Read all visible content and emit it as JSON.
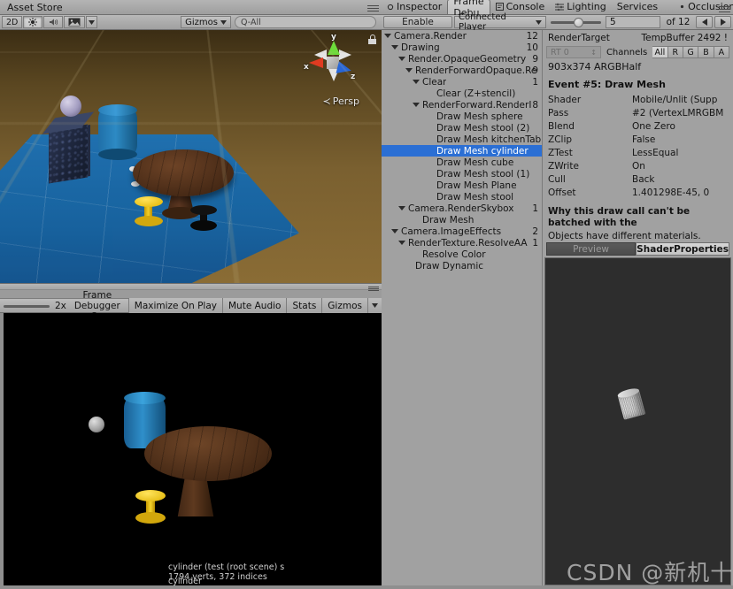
{
  "left_panel": {
    "tab_label": "Asset Store",
    "scene_toolbar": {
      "mode_2d": "2D",
      "lighting_icon": "sun-icon",
      "audio_icon": "speaker-icon",
      "fx_icon": "image-effects-icon",
      "fx_dropdown_icon": "chevron-down-icon",
      "gizmos_label": "Gizmos",
      "gizmos_dropdown_icon": "chevron-down-icon",
      "search_placeholder": "Q-All",
      "search_value": "Q-All",
      "search_icon": "search-icon"
    },
    "scene_view": {
      "axis_gizmo": {
        "x_label": "x",
        "y_label": "y",
        "z_label": "z"
      },
      "projection_label": "Persp",
      "projection_arrow_icon": "chevron-left-icon",
      "lock_icon": "lock-icon",
      "objects": [
        "cube",
        "sphere",
        "cylinder",
        "kitchenTable",
        "stool",
        "stool (1)",
        "stool (2)",
        "Plane"
      ]
    },
    "game_toolbar": {
      "zoom_value": "2x",
      "status": "Frame Debugger On",
      "maximize_on_play": "Maximize On Play",
      "mute_audio": "Mute Audio",
      "stats": "Stats",
      "gizmos": "Gizmos",
      "gizmos_dropdown_icon": "chevron-down-icon"
    }
  },
  "right_panel": {
    "tabs": [
      {
        "label": "Inspector",
        "icon": "inspector-icon",
        "selected": false
      },
      {
        "label": "Frame Debu",
        "icon": "",
        "selected": true
      },
      {
        "label": "Console",
        "icon": "console-icon",
        "selected": false
      },
      {
        "label": "Lighting",
        "icon": "lighting-icon",
        "selected": false
      },
      {
        "label": "Services",
        "icon": "",
        "selected": false
      },
      {
        "label": "Occlusion",
        "icon": "occlusion-icon",
        "selected": false
      }
    ],
    "toolbar": {
      "enable_label": "Enable",
      "target_label": "Connected Player",
      "target_dropdown_icon": "chevron-down-icon",
      "event_index": "5",
      "event_total": "of 12",
      "prev_icon": "arrow-left-icon",
      "next_icon": "arrow-right-icon"
    },
    "tree": [
      {
        "label": "Camera.Render",
        "count": "12",
        "indent": 0,
        "expandable": true,
        "selected": false
      },
      {
        "label": "Drawing",
        "count": "10",
        "indent": 1,
        "expandable": true,
        "selected": false
      },
      {
        "label": "Render.OpaqueGeometry",
        "count": "9",
        "indent": 2,
        "expandable": true,
        "selected": false
      },
      {
        "label": "RenderForwardOpaque.Re",
        "count": "9",
        "indent": 3,
        "expandable": true,
        "selected": false
      },
      {
        "label": "Clear",
        "count": "1",
        "indent": 4,
        "expandable": true,
        "selected": false
      },
      {
        "label": "Clear (Z+stencil)",
        "count": "",
        "indent": 6,
        "expandable": false,
        "selected": false
      },
      {
        "label": "RenderForward.RenderI",
        "count": "8",
        "indent": 4,
        "expandable": true,
        "selected": false
      },
      {
        "label": "Draw Mesh sphere",
        "count": "",
        "indent": 6,
        "expandable": false,
        "selected": false
      },
      {
        "label": "Draw Mesh stool (2)",
        "count": "",
        "indent": 6,
        "expandable": false,
        "selected": false
      },
      {
        "label": "Draw Mesh kitchenTable",
        "count": "",
        "indent": 6,
        "expandable": false,
        "selected": false
      },
      {
        "label": "Draw Mesh cylinder",
        "count": "",
        "indent": 6,
        "expandable": false,
        "selected": true
      },
      {
        "label": "Draw Mesh cube",
        "count": "",
        "indent": 6,
        "expandable": false,
        "selected": false
      },
      {
        "label": "Draw Mesh stool (1)",
        "count": "",
        "indent": 6,
        "expandable": false,
        "selected": false
      },
      {
        "label": "Draw Mesh Plane",
        "count": "",
        "indent": 6,
        "expandable": false,
        "selected": false
      },
      {
        "label": "Draw Mesh stool",
        "count": "",
        "indent": 6,
        "expandable": false,
        "selected": false
      },
      {
        "label": "Camera.RenderSkybox",
        "count": "1",
        "indent": 2,
        "expandable": true,
        "selected": false
      },
      {
        "label": "Draw Mesh",
        "count": "",
        "indent": 4,
        "expandable": false,
        "selected": false
      },
      {
        "label": "Camera.ImageEffects",
        "count": "2",
        "indent": 1,
        "expandable": true,
        "selected": false
      },
      {
        "label": "RenderTexture.ResolveAA",
        "count": "1",
        "indent": 2,
        "expandable": true,
        "selected": false
      },
      {
        "label": "Resolve Color",
        "count": "",
        "indent": 4,
        "expandable": false,
        "selected": false
      },
      {
        "label": "Draw Dynamic",
        "count": "",
        "indent": 3,
        "expandable": false,
        "selected": false
      }
    ],
    "detail": {
      "render_target_label": "RenderTarget",
      "render_target_value": "TempBuffer 2492 !",
      "rt_dropdown_value": "RT 0",
      "rt_dropdown_icon": "chevron-updown-icon",
      "channels_label": "Channels",
      "channel_buttons": [
        "All",
        "R",
        "G",
        "B",
        "A"
      ],
      "channel_selected": "All",
      "size_label": "903x374 ARGBHalf",
      "event_title": "Event #5: Draw Mesh",
      "properties": [
        {
          "key": "Shader",
          "value": "Mobile/Unlit (Supp"
        },
        {
          "key": "Pass",
          "value": "#2 (VertexLMRGBM"
        },
        {
          "key": "Blend",
          "value": "One Zero"
        },
        {
          "key": "ZClip",
          "value": "False"
        },
        {
          "key": "ZTest",
          "value": "LessEqual"
        },
        {
          "key": "ZWrite",
          "value": "On"
        },
        {
          "key": "Cull",
          "value": "Back"
        },
        {
          "key": "Offset",
          "value": "1.401298E-45, 0"
        }
      ],
      "batch_note": "Why this draw call can't be batched with the",
      "batch_reason": "Objects have different materials.",
      "preview_tabs": [
        {
          "label": "Preview",
          "selected": false
        },
        {
          "label": "ShaderProperties",
          "selected": true
        }
      ],
      "preview_mesh_name": "cylinder",
      "preview_mesh_info": "cylinder (test (root scene) s",
      "preview_mesh_stats": "1794 verts, 372 indices"
    }
  },
  "watermark": {
    "text": "CSDN @新机十之脑"
  },
  "colors": {
    "selection_blue": "#2b6fd4",
    "panel_gray": "#a1a1a1",
    "chrome_gray": "#b4b4b4",
    "game_black": "#000000",
    "preview_dark": "#2d2d2d"
  }
}
